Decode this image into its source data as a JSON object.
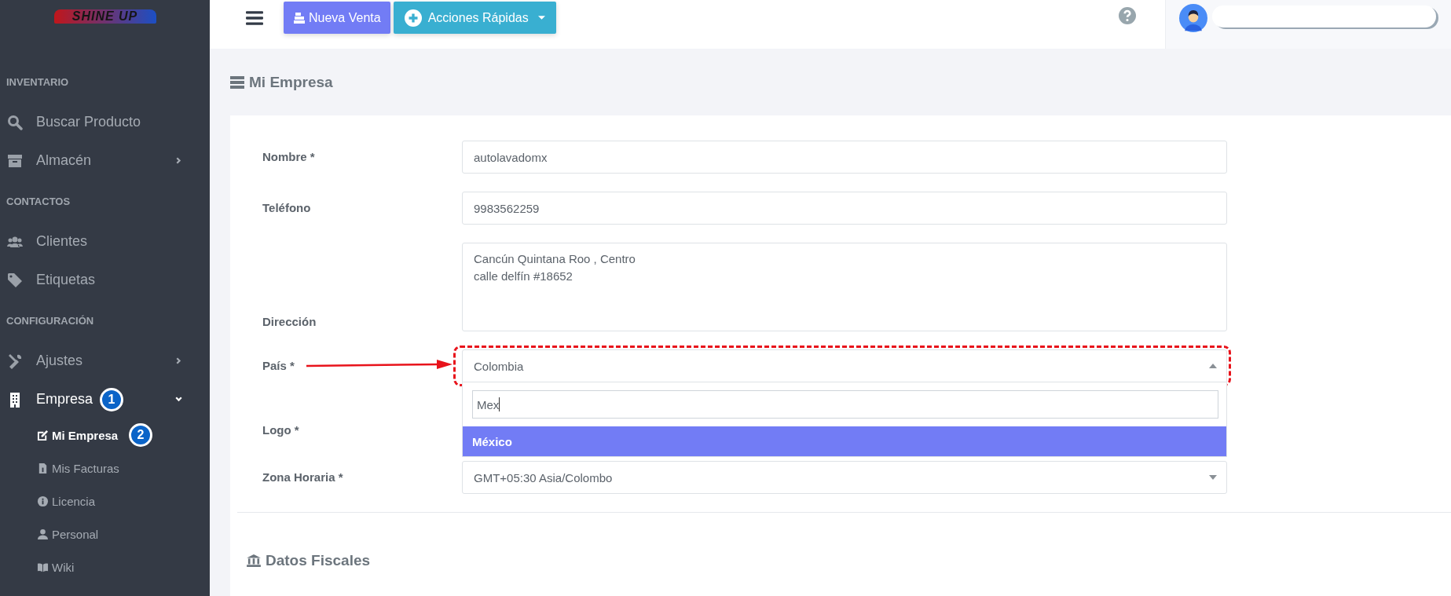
{
  "sidebar": {
    "logo": "SHINE UP",
    "sections": [
      {
        "heading": "INVENTARIO",
        "items": [
          {
            "label": "Buscar Producto",
            "has_submenu": false
          },
          {
            "label": "Almacén",
            "has_submenu": true,
            "expanded": false
          }
        ]
      },
      {
        "heading": "CONTACTOS",
        "items": [
          {
            "label": "Clientes",
            "has_submenu": false
          },
          {
            "label": "Etiquetas",
            "has_submenu": false
          }
        ]
      },
      {
        "heading": "CONFIGURACIÓN",
        "items": [
          {
            "label": "Ajustes",
            "has_submenu": true,
            "expanded": false
          },
          {
            "label": "Empresa",
            "has_submenu": true,
            "expanded": true,
            "badge": "1",
            "children": [
              {
                "label": "Mi Empresa",
                "selected": true,
                "badge": "2"
              },
              {
                "label": "Mis Facturas",
                "selected": false
              },
              {
                "label": "Licencia",
                "selected": false
              },
              {
                "label": "Personal",
                "selected": false
              },
              {
                "label": "Wiki",
                "selected": false
              }
            ]
          }
        ]
      }
    ]
  },
  "topbar": {
    "buttons": [
      {
        "label": "Nueva Venta",
        "kind": "primary",
        "dropdown": false
      },
      {
        "label": "Acciones Rápidas",
        "kind": "info",
        "dropdown": true
      }
    ]
  },
  "page_title": "Mi Empresa",
  "form": {
    "fields": [
      {
        "label": "Nombre *",
        "kind": "input",
        "value": "autolavadomx"
      },
      {
        "label": "Teléfono",
        "kind": "input",
        "value": "9983562259"
      },
      {
        "label": "Dirección",
        "kind": "textarea",
        "value": "Cancún Quintana Roo , Centro\ncalle delfín #18652"
      },
      {
        "label": "País *",
        "kind": "select",
        "value": "Colombia",
        "open": true,
        "search": "Mex",
        "options": [
          {
            "label": "México",
            "selected": true
          }
        ]
      },
      {
        "label": "Logo *",
        "kind": "covered"
      },
      {
        "label": "Zona Horaria *",
        "kind": "select",
        "value": "GMT+05:30 Asia/Colombo",
        "open": false
      }
    ]
  },
  "section_title": "Datos Fiscales"
}
